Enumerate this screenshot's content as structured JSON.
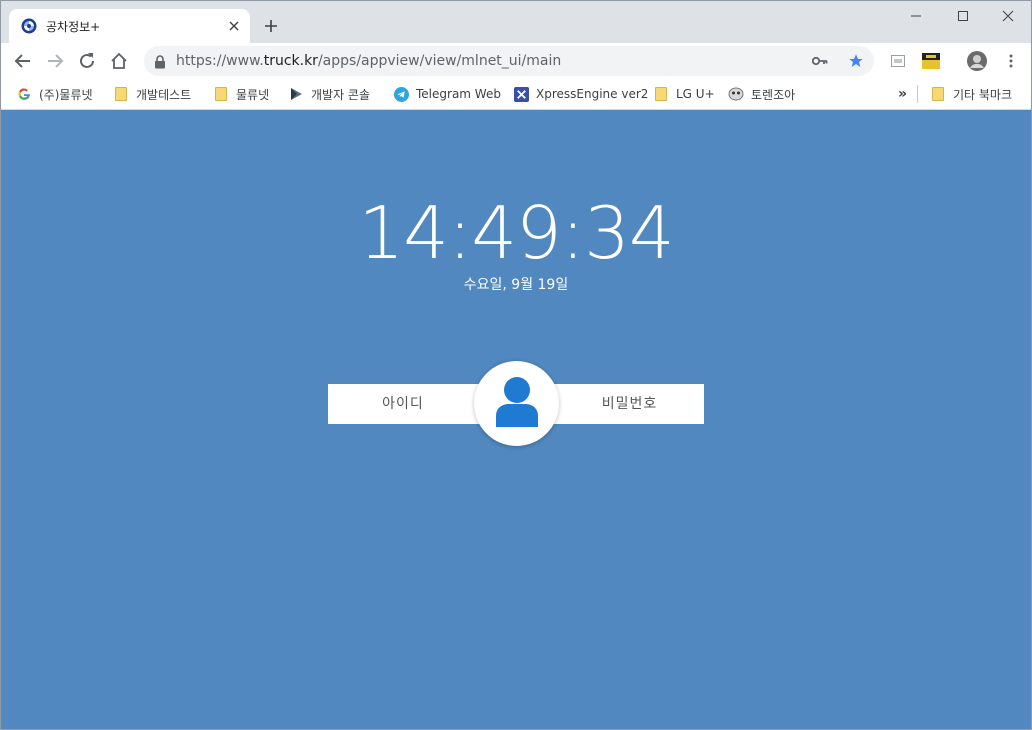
{
  "browser": {
    "tab": {
      "title": "공차정보+",
      "favicon": "swirl-logo-icon"
    },
    "new_tab_icon": "plus-icon",
    "window_controls": [
      "minimize-icon",
      "maximize-icon",
      "close-icon"
    ],
    "toolbar": {
      "back_icon": "arrow-left-icon",
      "forward_icon": "arrow-right-icon",
      "reload_icon": "reload-icon",
      "home_icon": "home-icon",
      "url_scheme": "https://www.",
      "url_host": "truck.kr",
      "url_path": "/apps/appview/view/mlnet_ui/main",
      "lock_icon": "lock-icon",
      "key_icon": "key-icon",
      "star_icon": "star-icon",
      "star_color": "#4285f4",
      "extensions": [
        "image-icon",
        "extension-icon"
      ],
      "profile_icon": "profile-avatar-icon",
      "menu_icon": "more-vert-icon"
    },
    "bookmarks": {
      "items": [
        {
          "label": "(주)물류넷",
          "icon": "google-icon"
        },
        {
          "label": "개발테스트",
          "icon": "folder-icon"
        },
        {
          "label": "물류넷",
          "icon": "folder-icon"
        },
        {
          "label": "개발자 콘솔",
          "icon": "play-console-icon"
        },
        {
          "label": "Telegram Web",
          "icon": "telegram-icon"
        },
        {
          "label": "XpressEngine ver2",
          "icon": "xe-icon"
        },
        {
          "label": "LG U+",
          "icon": "folder-icon"
        },
        {
          "label": "토렌조아",
          "icon": "mascot-icon"
        }
      ],
      "overflow": "»",
      "other": {
        "label": "기타 북마크",
        "icon": "folder-icon"
      }
    }
  },
  "page": {
    "background": "#5088bf",
    "clock": "14:49:34",
    "date": "수요일, 9월 19일",
    "login": {
      "id_placeholder": "아이디",
      "password_placeholder": "비밀번호",
      "avatar_icon": "user-icon",
      "avatar_color": "#1f7bd1"
    }
  }
}
